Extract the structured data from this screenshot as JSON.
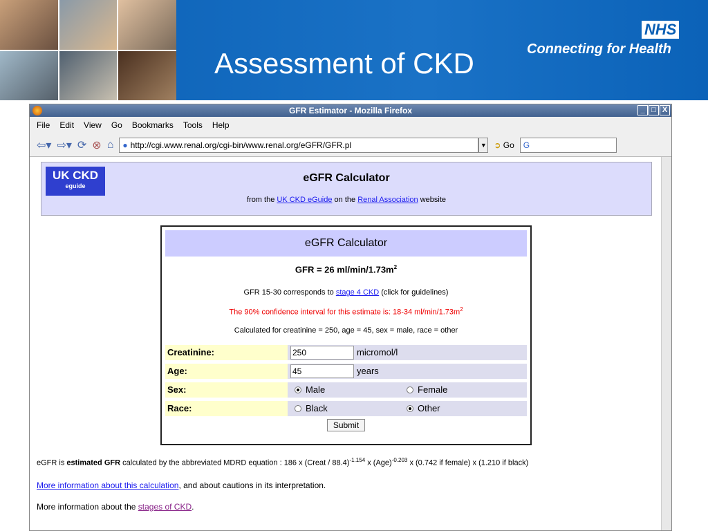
{
  "slide": {
    "title": "Assessment of CKD",
    "nhs": "NHS",
    "nhs_sub": "Connecting for Health"
  },
  "browser": {
    "title": "GFR Estimator - Mozilla Firefox",
    "menu": [
      "File",
      "Edit",
      "View",
      "Go",
      "Bookmarks",
      "Tools",
      "Help"
    ],
    "url": "http://cgi.www.renal.org/cgi-bin/www.renal.org/eGFR/GFR.pl",
    "go": "Go",
    "search": "G"
  },
  "page": {
    "logo": "UK CKD",
    "logo_sub": "eguide",
    "heading": "eGFR Calculator",
    "from": "from the",
    "link1": "UK CKD eGuide",
    "on": "on the",
    "link2": "Renal Association",
    "website": "website"
  },
  "calc": {
    "header": "eGFR Calculator",
    "result": "GFR = 26 ml/min/1.73m",
    "result_sup": "2",
    "stage_pre": "GFR 15-30 corresponds to",
    "stage_link": "stage 4 CKD",
    "stage_post": "(click for guidelines)",
    "ci": "The 90% confidence interval for this estimate is: 18-34 ml/min/1.73m",
    "ci_sup": "2",
    "calc_for": "Calculated for creatinine = 250, age = 45, sex = male, race = other",
    "creat_label": "Creatinine:",
    "creat_value": "250",
    "creat_unit": "micromol/l",
    "age_label": "Age:",
    "age_value": "45",
    "age_unit": "years",
    "sex_label": "Sex:",
    "male": "Male",
    "female": "Female",
    "race_label": "Race:",
    "black": "Black",
    "other": "Other",
    "submit": "Submit"
  },
  "footer": {
    "eq_pre": "eGFR is",
    "eq_bold": "estimated GFR",
    "eq_mid": "calculated by the abbreviated MDRD equation : 186 x (Creat / 88.4)",
    "eq_exp1": "-1.154",
    "eq_age": "x (Age)",
    "eq_exp2": "-0.203",
    "eq_post": "x (0.742 if female) x (1.210 if black)",
    "more_link": "More information about this calculation",
    "more_post": ", and about cautions in its interpretation.",
    "stages_pre": "More information about the",
    "stages_link": "stages of CKD",
    "stages_post": "."
  }
}
